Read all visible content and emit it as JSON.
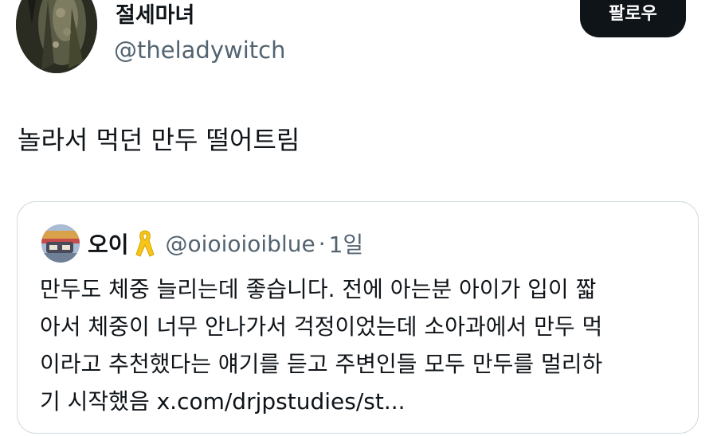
{
  "author": {
    "display_name": "절세마녀",
    "handle": "@theladywitch",
    "avatar_icon": "profile-photo"
  },
  "follow": {
    "label": "팔로우"
  },
  "tweet": {
    "text": "놀라서 먹던 만두 떨어트림"
  },
  "quoted_tweet": {
    "name": "오이",
    "badge_icon": "yellow-ribbon-icon",
    "handle": "@oioioioiblue",
    "separator": "·",
    "time": "1일",
    "lines": [
      "만두도 체중 늘리는데 좋습니다. 전에 아는분 아이가 입이 짧",
      "아서 체중이 너무 안나가서 걱정이었는데 소아과에서 만두 먹",
      "이라고 추천했다는 얘기를 듣고 주변인들 모두 만두를 멀리하",
      "기 시작했음 x.com/drjpstudies/st..."
    ]
  },
  "colors": {
    "text_primary": "#0f1419",
    "text_secondary": "#536471",
    "button_bg": "#0f1419",
    "card_border": "#cfd9de",
    "ribbon": "#f5c518"
  }
}
